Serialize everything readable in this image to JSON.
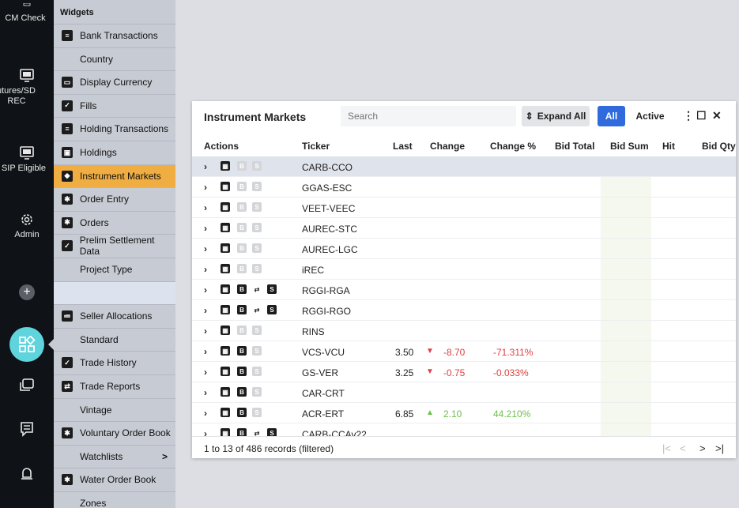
{
  "rail": {
    "items": [
      {
        "label": "CM Check",
        "icon": "monitor-icon"
      },
      {
        "label": "utures/SD... REC",
        "icon": "monitor-icon"
      },
      {
        "label": "SIP Eligible",
        "icon": "monitor-icon"
      },
      {
        "label": "Admin",
        "icon": "gear-icon"
      }
    ],
    "plus": "+"
  },
  "widgets": {
    "header": "Widgets",
    "items": [
      {
        "label": "Bank Transactions",
        "icon": "list-icon"
      },
      {
        "label": "Country",
        "icon": ""
      },
      {
        "label": "Display Currency",
        "icon": "currency-icon"
      },
      {
        "label": "Fills",
        "icon": "check-box-icon"
      },
      {
        "label": "Holding Transactions",
        "icon": "list-icon"
      },
      {
        "label": "Holdings",
        "icon": "holdings-icon"
      },
      {
        "label": "Instrument Markets",
        "icon": "market-icon"
      },
      {
        "label": "Order Entry",
        "icon": "ticket-icon"
      },
      {
        "label": "Orders",
        "icon": "ticket-icon"
      },
      {
        "label": "Prelim Settlement Data",
        "icon": "check-box-icon"
      },
      {
        "label": "Project Type",
        "icon": ""
      },
      {
        "label": "",
        "icon": ""
      },
      {
        "label": "Seller Allocations",
        "icon": "allocation-icon"
      },
      {
        "label": "Standard",
        "icon": ""
      },
      {
        "label": "Trade History",
        "icon": "check-box-icon"
      },
      {
        "label": "Trade Reports",
        "icon": "exchange-icon"
      },
      {
        "label": "Vintage",
        "icon": ""
      },
      {
        "label": "Voluntary Order Book",
        "icon": "ticket-icon"
      },
      {
        "label": "Watchlists",
        "icon": "",
        "arrow": ">"
      },
      {
        "label": "Water Order Book",
        "icon": "ticket-icon"
      },
      {
        "label": "Zones",
        "icon": ""
      }
    ]
  },
  "panel": {
    "title": "Instrument Markets",
    "search_placeholder": "Search",
    "expand_all": "Expand All",
    "filter_all": "All",
    "filter_active": "Active",
    "columns": [
      "Actions",
      "Ticker",
      "Last",
      "Change",
      "Change %",
      "Bid Total",
      "Bid Sum",
      "Hit",
      "Bid Qty"
    ],
    "rows": [
      {
        "ticker": "CARB-CCO",
        "last": "",
        "change": "",
        "dir": "",
        "change_pct": "",
        "b": false,
        "x": false,
        "s": false
      },
      {
        "ticker": "GGAS-ESC",
        "last": "",
        "change": "",
        "dir": "",
        "change_pct": "",
        "b": false,
        "x": false,
        "s": false
      },
      {
        "ticker": "VEET-VEEC",
        "last": "",
        "change": "",
        "dir": "",
        "change_pct": "",
        "b": false,
        "x": false,
        "s": false
      },
      {
        "ticker": "AUREC-STC",
        "last": "",
        "change": "",
        "dir": "",
        "change_pct": "",
        "b": false,
        "x": false,
        "s": false
      },
      {
        "ticker": "AUREC-LGC",
        "last": "",
        "change": "",
        "dir": "",
        "change_pct": "",
        "b": false,
        "x": false,
        "s": false
      },
      {
        "ticker": "iREC",
        "last": "",
        "change": "",
        "dir": "",
        "change_pct": "",
        "b": false,
        "x": false,
        "s": false
      },
      {
        "ticker": "RGGI-RGA",
        "last": "",
        "change": "",
        "dir": "",
        "change_pct": "",
        "b": true,
        "x": true,
        "s": true
      },
      {
        "ticker": "RGGI-RGO",
        "last": "",
        "change": "",
        "dir": "",
        "change_pct": "",
        "b": true,
        "x": true,
        "s": true
      },
      {
        "ticker": "RINS",
        "last": "",
        "change": "",
        "dir": "",
        "change_pct": "",
        "b": false,
        "x": false,
        "s": false
      },
      {
        "ticker": "VCS-VCU",
        "last": "3.50",
        "change": "-8.70",
        "dir": "down",
        "change_pct": "-71.311%",
        "b": true,
        "x": false,
        "s": false
      },
      {
        "ticker": "GS-VER",
        "last": "3.25",
        "change": "-0.75",
        "dir": "down",
        "change_pct": "-0.033%",
        "b": true,
        "x": false,
        "s": false
      },
      {
        "ticker": "CAR-CRT",
        "last": "",
        "change": "",
        "dir": "",
        "change_pct": "",
        "b": true,
        "x": false,
        "s": false
      },
      {
        "ticker": "ACR-ERT",
        "last": "6.85",
        "change": "2.10",
        "dir": "up",
        "change_pct": "44.210%",
        "b": true,
        "x": false,
        "s": false
      },
      {
        "ticker": "CARB-CCAv22",
        "last": "",
        "change": "",
        "dir": "",
        "change_pct": "",
        "b": true,
        "x": true,
        "s": true
      }
    ],
    "footer": "1 to 13 of 486 records (filtered)",
    "colors": {
      "accent": "#2f6bdc",
      "active_widget": "#f0ad41",
      "negative": "#e04040",
      "positive": "#6cc04a"
    }
  }
}
